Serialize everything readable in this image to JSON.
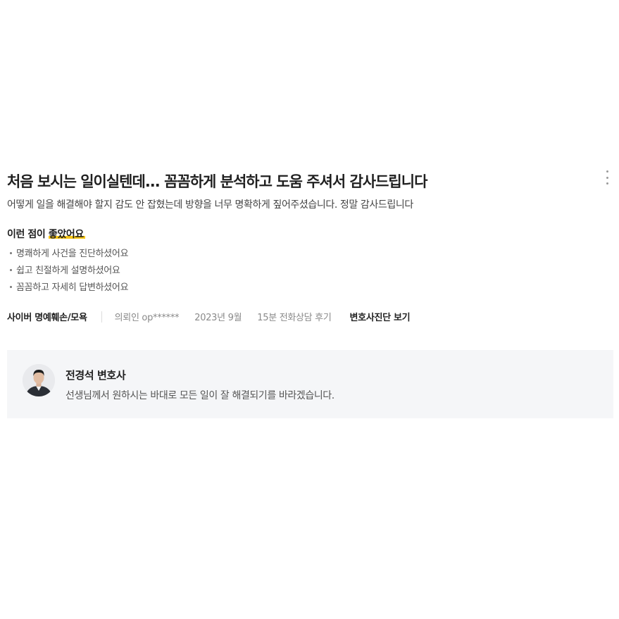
{
  "review": {
    "title": "처음 보시는 일이실텐데... 꼼꼼하게 분석하고 도움 주셔서 감사드립니다",
    "body": "어떻게 일을 해결해야 할지 감도 안 잡혔는데 방향을 너무 명확하게 짚어주셨습니다. 정말 감사드립니다",
    "good_points": {
      "heading_prefix": "이런 점이 ",
      "heading_highlight": "좋았어요",
      "items": [
        "명쾌하게 사건을 진단하셨어요",
        "쉽고 친절하게 설명하셨어요",
        "꼼꼼하고 자세히 답변하셨어요"
      ]
    },
    "meta": {
      "category": "사이버 명예훼손/모욕",
      "client": "의뢰인 op******",
      "date": "2023년 9월",
      "consult": "15분 전화상담 후기",
      "diagnosis_link": "변호사진단 보기"
    }
  },
  "reply": {
    "lawyer_name": "전경석 변호사",
    "text": "선생님께서 원하시는 바대로 모든 일이 잘 해결되기를 바라겠습니다."
  },
  "icons": {
    "more": "more-vertical-icon"
  },
  "colors": {
    "highlight": "#f6c516",
    "reply_bg": "#f5f6f8"
  }
}
